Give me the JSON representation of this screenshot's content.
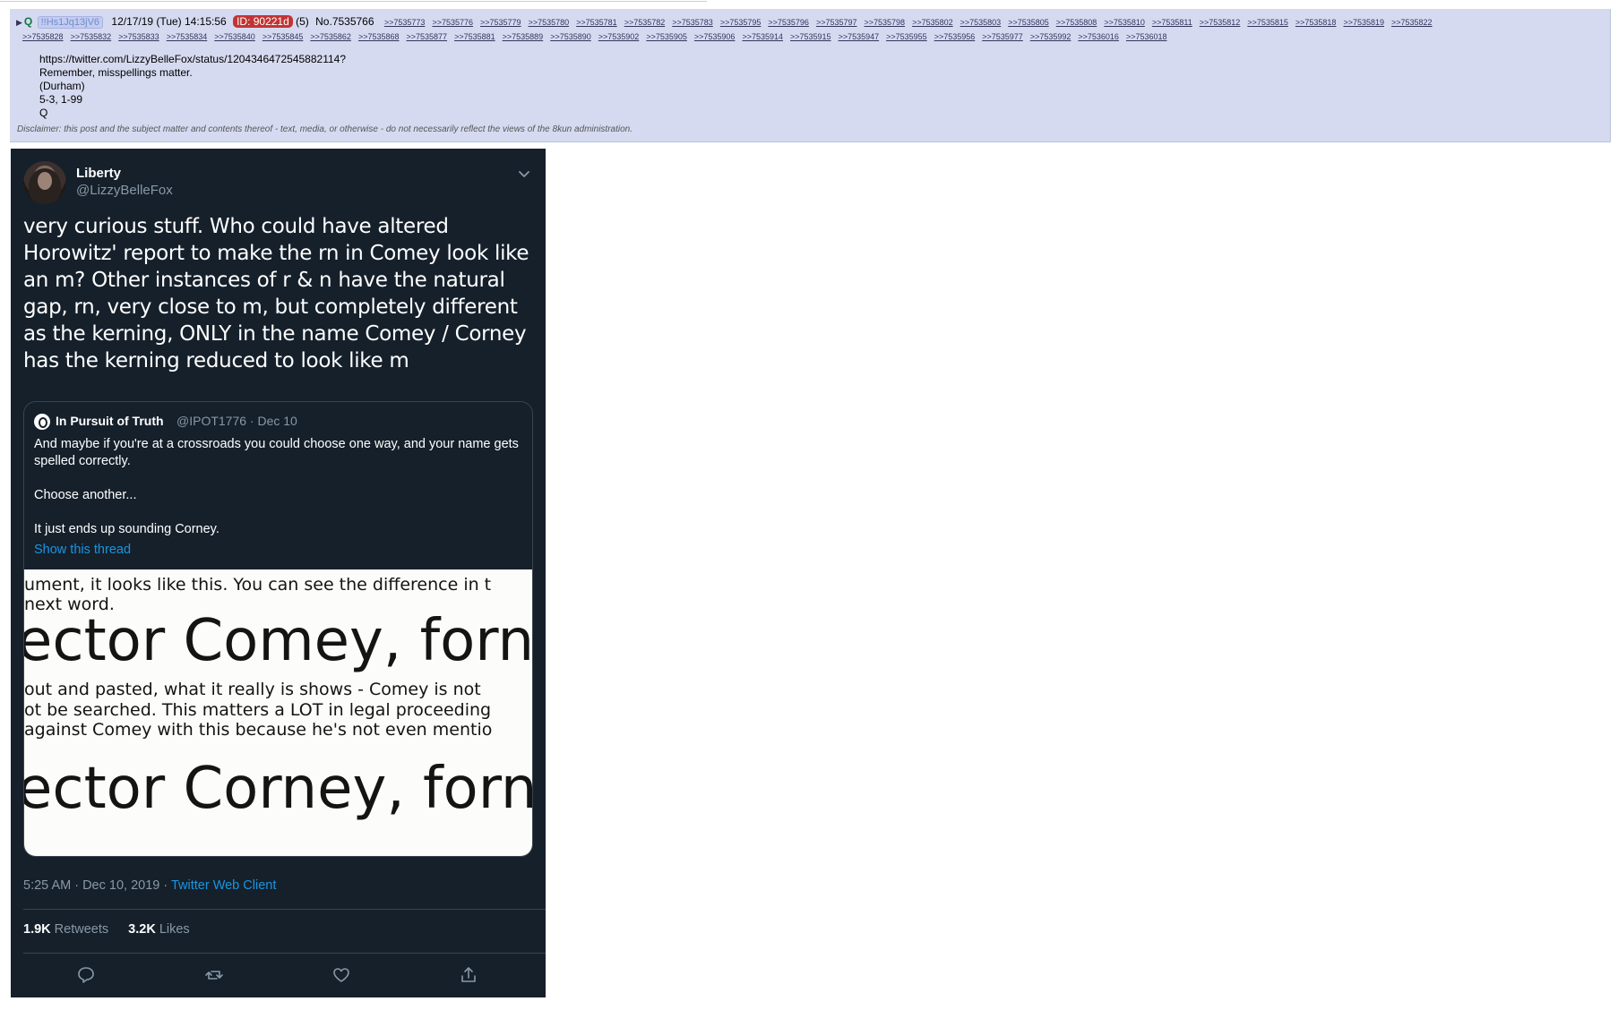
{
  "post": {
    "toggle": "▶",
    "name": "Q",
    "tripcode": "!!Hs1Jq13jV6",
    "date": "12/17/19 (Tue) 14:15:56",
    "id_label": "ID: 90221d",
    "reply_count": "(5)",
    "post_number": "No.7535766",
    "backlinks_line1": [
      ">>7535773",
      ">>7535776",
      ">>7535779",
      ">>7535780",
      ">>7535781",
      ">>7535782",
      ">>7535783",
      ">>7535795",
      ">>7535796",
      ">>7535797",
      ">>7535798",
      ">>7535802",
      ">>7535803",
      ">>7535805",
      ">>7535808",
      ">>7535810",
      ">>7535811",
      ">>7535812",
      ">>7535815",
      ">>7535818",
      ">>7535819",
      ">>7535822"
    ],
    "backlinks_line2": [
      ">>7535828",
      ">>7535832",
      ">>7535833",
      ">>7535834",
      ">>7535840",
      ">>7535845",
      ">>7535862",
      ">>7535868",
      ">>7535877",
      ">>7535881",
      ">>7535889",
      ">>7535890",
      ">>7535902",
      ">>7535905",
      ">>7535906",
      ">>7535914",
      ">>7535915",
      ">>7535947",
      ">>7535955",
      ">>7535956",
      ">>7535977",
      ">>7535992",
      ">>7536016",
      ">>7536018"
    ],
    "body_lines": [
      "https://twitter.com/LizzyBelleFox/status/1204346472545882114?",
      "Remember, misspellings matter.",
      "(Durham)",
      "5-3, 1-99",
      "Q"
    ],
    "disclaimer": "Disclaimer: this post and the subject matter and contents thereof - text, media, or otherwise - do not necessarily reflect the views of the 8kun administration."
  },
  "tweet": {
    "display_name": "Liberty",
    "handle": "@LizzyBelleFox",
    "text": "very curious stuff. Who could have altered Horowitz' report to make the rn in Comey look like an m? Other instances of r & n have the natural gap, rn, very close to m, but completely different as the kerning, ONLY in the name Comey / Corney has the kerning reduced to look like m",
    "quote": {
      "name": "In Pursuit of Truth",
      "meta": "@IPOT1776 · Dec 10",
      "paragraphs": [
        "And maybe if you're at a crossroads you could choose one way, and your name gets spelled correctly.",
        "Choose another...",
        "It just ends up sounding Corney."
      ],
      "show_thread": "Show this thread",
      "image_lines": {
        "l1": "ument, it looks like this.  You can see the difference in t",
        "l2": "next word.",
        "l3": "ector Comey, forn",
        "l4": " out and pasted, what it really is shows - Comey is not",
        "l5": "ot be searched.  This matters a LOT in legal proceeding",
        "l6": " against Comey with this because he's not even mentio",
        "l7": "ector Corney, forn"
      }
    },
    "time": "5:25 AM · Dec 10, 2019 · ",
    "client": "Twitter Web Client",
    "retweets_count": "1.9K",
    "retweets_label": " Retweets",
    "likes_count": "3.2K",
    "likes_label": " Likes"
  },
  "colors": {
    "post_bg": "#d6daf0",
    "tweet_bg": "#15202b",
    "link_blue": "#1b95e0",
    "id_badge": "#c23434"
  }
}
